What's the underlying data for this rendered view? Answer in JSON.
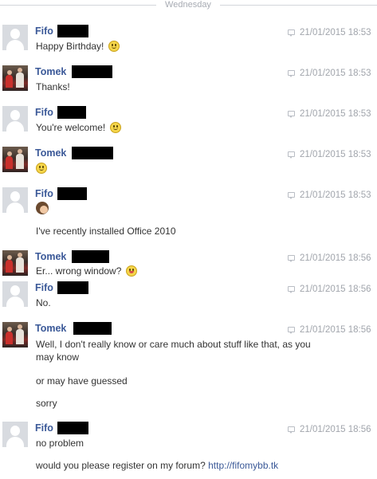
{
  "day_divider": "Wednesday",
  "messages": [
    {
      "name": "Fifo",
      "time": "21/01/2015 18:53",
      "lines": [
        "Happy Birthday!"
      ]
    },
    {
      "name": "Tomek",
      "time": "21/01/2015 18:53",
      "lines": [
        "Thanks!"
      ]
    },
    {
      "name": "Fifo",
      "time": "21/01/2015 18:53",
      "lines": [
        "You're welcome!"
      ]
    },
    {
      "name": "Tomek",
      "time": "21/01/2015 18:53",
      "lines": []
    },
    {
      "name": "Fifo",
      "time": "21/01/2015 18:53",
      "lines": [
        "I've recently installed Office 2010"
      ]
    },
    {
      "name": "Tomek",
      "time": "21/01/2015 18:56",
      "lines": [
        "Er... wrong window?"
      ]
    },
    {
      "name": "Fifo",
      "time": "21/01/2015 18:56",
      "lines": [
        "No."
      ]
    },
    {
      "name": "Tomek",
      "time": "21/01/2015 18:56",
      "lines": [
        "Well, I don't really know or care much about stuff like that, as you may know",
        "or may have guessed",
        "sorry"
      ]
    },
    {
      "name": "Fifo",
      "time": "21/01/2015 18:56",
      "lines": [
        "no problem",
        "would you please register on my forum?"
      ],
      "link": "http://fifomybb.tk"
    }
  ]
}
